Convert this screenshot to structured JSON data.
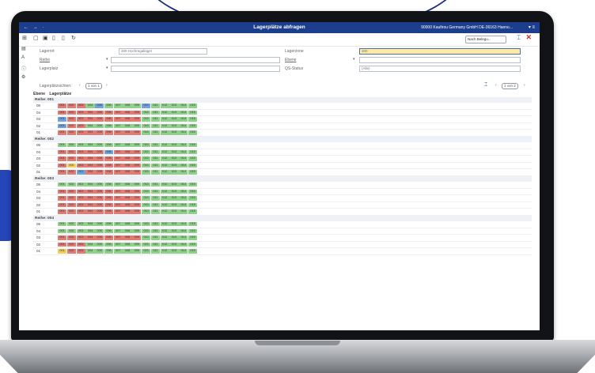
{
  "app": {
    "title": "Lagerplätze abfragen",
    "company": "90000  Kaufirou Germany GmbH DE-36163 Hanno..."
  },
  "toolbar": {
    "view_select": "Nach Belegu..."
  },
  "form": {
    "lagerort_label": "Lagerort",
    "lagerort_value": "300 Hochregallager",
    "reihe_label": "Reihe",
    "lagerplatz_label": "Lagerplatz",
    "lagerzone_label": "Lagerzone",
    "lagerzone_value": "300",
    "ebene_label": "Ebene",
    "qs_label": "QS-Status",
    "qs_value": "(Alle)"
  },
  "pager": {
    "left_label": "Lagerplätzsichten:",
    "left_page": "1 von 1",
    "right_page": "1 von 2"
  },
  "grid": {
    "header_level": "Ebene",
    "header_slots": "Lagerplätze",
    "slot_labels": [
      "001",
      "002",
      "003",
      "004",
      "005",
      "006",
      "007",
      "008",
      "009",
      "010",
      "011",
      "012",
      "013",
      "014",
      "015"
    ],
    "sections": [
      {
        "label": "Reihe: 001",
        "rows": [
          {
            "level": "05",
            "states": [
              "u",
              "u",
              "u",
              "f",
              "b",
              "f",
              "f",
              "f",
              "f",
              "b",
              "f",
              "f",
              "f",
              "f",
              "f"
            ]
          },
          {
            "level": "04",
            "states": [
              "u",
              "u",
              "u",
              "u",
              "u",
              "u",
              "u",
              "u",
              "u",
              "f",
              "f",
              "f",
              "f",
              "f",
              "f"
            ]
          },
          {
            "level": "03",
            "states": [
              "b",
              "u",
              "u",
              "u",
              "u",
              "u",
              "u",
              "u",
              "u",
              "f",
              "f",
              "f",
              "f",
              "f",
              "f"
            ]
          },
          {
            "level": "02",
            "states": [
              "b",
              "u",
              "u",
              "f",
              "f",
              "f",
              "f",
              "f",
              "f",
              "f",
              "f",
              "f",
              "f",
              "f",
              "f"
            ]
          },
          {
            "level": "01",
            "states": [
              "u",
              "u",
              "u",
              "u",
              "u",
              "u",
              "u",
              "u",
              "u",
              "f",
              "f",
              "f",
              "f",
              "f",
              "f"
            ]
          }
        ]
      },
      {
        "label": "Reihe: 002",
        "rows": [
          {
            "level": "05",
            "states": [
              "f",
              "f",
              "f",
              "f",
              "f",
              "f",
              "f",
              "f",
              "f",
              "f",
              "f",
              "f",
              "f",
              "f",
              "f"
            ]
          },
          {
            "level": "04",
            "states": [
              "u",
              "u",
              "u",
              "u",
              "u",
              "b",
              "u",
              "u",
              "u",
              "f",
              "f",
              "f",
              "f",
              "f",
              "f"
            ]
          },
          {
            "level": "03",
            "states": [
              "u",
              "u",
              "u",
              "u",
              "u",
              "u",
              "u",
              "u",
              "u",
              "f",
              "f",
              "f",
              "f",
              "f",
              "f"
            ]
          },
          {
            "level": "02",
            "states": [
              "u",
              "p",
              "u",
              "u",
              "u",
              "u",
              "u",
              "u",
              "u",
              "f",
              "f",
              "f",
              "f",
              "f",
              "f"
            ]
          },
          {
            "level": "01",
            "states": [
              "u",
              "u",
              "b",
              "u",
              "u",
              "u",
              "u",
              "u",
              "u",
              "f",
              "f",
              "f",
              "f",
              "f",
              "f"
            ]
          }
        ]
      },
      {
        "label": "Reihe: 003",
        "rows": [
          {
            "level": "05",
            "states": [
              "f",
              "f",
              "f",
              "f",
              "f",
              "f",
              "f",
              "f",
              "f",
              "f",
              "f",
              "f",
              "f",
              "f",
              "f"
            ]
          },
          {
            "level": "04",
            "states": [
              "u",
              "u",
              "u",
              "u",
              "u",
              "u",
              "u",
              "u",
              "u",
              "f",
              "f",
              "f",
              "f",
              "f",
              "f"
            ]
          },
          {
            "level": "03",
            "states": [
              "u",
              "u",
              "u",
              "u",
              "u",
              "u",
              "u",
              "u",
              "u",
              "f",
              "f",
              "f",
              "f",
              "f",
              "f"
            ]
          },
          {
            "level": "02",
            "states": [
              "u",
              "u",
              "u",
              "u",
              "u",
              "u",
              "u",
              "u",
              "u",
              "f",
              "f",
              "f",
              "f",
              "f",
              "f"
            ]
          },
          {
            "level": "01",
            "states": [
              "u",
              "u",
              "u",
              "u",
              "u",
              "u",
              "u",
              "u",
              "u",
              "f",
              "f",
              "f",
              "f",
              "f",
              "f"
            ]
          }
        ]
      },
      {
        "label": "Reihe: 004",
        "rows": [
          {
            "level": "05",
            "states": [
              "f",
              "f",
              "f",
              "f",
              "f",
              "f",
              "f",
              "f",
              "f",
              "f",
              "f",
              "f",
              "f",
              "f",
              "f"
            ]
          },
          {
            "level": "04",
            "states": [
              "f",
              "f",
              "f",
              "f",
              "f",
              "f",
              "f",
              "f",
              "f",
              "f",
              "f",
              "f",
              "f",
              "f",
              "f"
            ]
          },
          {
            "level": "03",
            "states": [
              "u",
              "u",
              "u",
              "u",
              "u",
              "u",
              "u",
              "u",
              "u",
              "f",
              "f",
              "f",
              "f",
              "f",
              "f"
            ]
          },
          {
            "level": "02",
            "states": [
              "u",
              "u",
              "u",
              "f",
              "f",
              "f",
              "f",
              "f",
              "f",
              "f",
              "f",
              "f",
              "f",
              "f",
              "f"
            ]
          },
          {
            "level": "01",
            "states": [
              "p",
              "u",
              "u",
              "f",
              "f",
              "f",
              "f",
              "f",
              "f",
              "f",
              "f",
              "f",
              "f",
              "f",
              "f"
            ]
          }
        ]
      }
    ]
  },
  "colors": {
    "titlebar": "#1c3e8c",
    "free": "#8fd18a",
    "used": "#e27b73",
    "blocked": "#6fa3e0",
    "partial": "#f2cf5b"
  }
}
